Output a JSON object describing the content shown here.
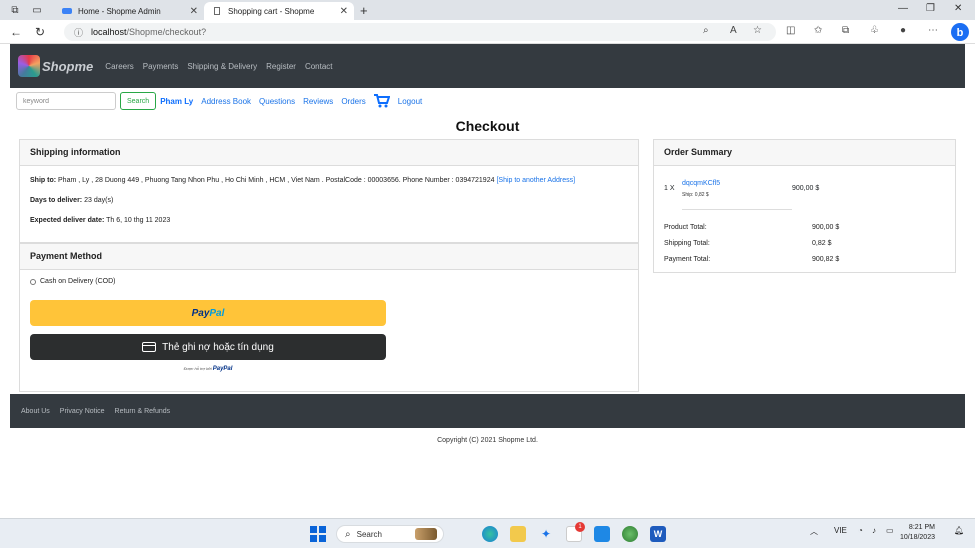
{
  "browser": {
    "tabs": [
      {
        "label": "Home - Shopme Admin",
        "active": false
      },
      {
        "label": "Shopping cart - Shopme",
        "active": true
      }
    ],
    "url_host": "localhost",
    "url_path": "/Shopme/checkout?"
  },
  "topnav": {
    "brand": "Shopme",
    "links": [
      "Careers",
      "Payments",
      "Shipping & Delivery",
      "Register",
      "Contact"
    ]
  },
  "subnav": {
    "search_placeholder": "keyword",
    "search_button": "Search",
    "user_name": "Pham Ly",
    "links": [
      "Address Book",
      "Questions",
      "Reviews",
      "Orders"
    ],
    "logout": "Logout"
  },
  "page_title": "Checkout",
  "shipping": {
    "header": "Shipping information",
    "ship_to_label": "Ship to:",
    "ship_to_value": "Pham , Ly , 28 Duong 449 , Phuong Tang Nhon Phu , Ho Chi Minh , HCM , Viet Nam . PostalCode : 00003656. Phone Number : 0394721924",
    "ship_to_link": "[Ship to another Address]",
    "days_label": "Days to deliver:",
    "days_value": "23 day(s)",
    "expected_label": "Expected deliver date:",
    "expected_value": "Th 6, 10 thg 11 2023"
  },
  "payment": {
    "header": "Payment Method",
    "cod_label": "Cash on Delivery (COD)",
    "paypal_p1": "Pay",
    "paypal_p2": "Pal",
    "card_button": "Thẻ ghi nợ hoặc tín dụng",
    "powered_by": "Được hỗ trợ bởi",
    "powered_brand": "PayPal"
  },
  "order_summary": {
    "header": "Order Summary",
    "item": {
      "qty": "1 X",
      "name": "dqcqmKCfl5",
      "ship": "Ship: 0,82 $",
      "price": "900,00 $"
    },
    "product_total_label": "Product Total:",
    "product_total": "900,00 $",
    "shipping_total_label": "Shipping Total:",
    "shipping_total": "0,82 $",
    "payment_total_label": "Payment Total:",
    "payment_total": "900,82 $"
  },
  "footer": {
    "links": [
      "About Us",
      "Privacy Notice",
      "Return & Refunds"
    ],
    "copyright": "Copyright (C) 2021 Shopme Ltd."
  },
  "taskbar": {
    "search_label": "Search",
    "lang": "VIE",
    "time": "8:21 PM",
    "date": "10/18/2023",
    "badge": "1"
  },
  "colors": {
    "navbar": "#343a40",
    "link": "#1a73e8",
    "paypal_yellow": "#ffc439",
    "paypal_dark": "#2c2e2f"
  }
}
